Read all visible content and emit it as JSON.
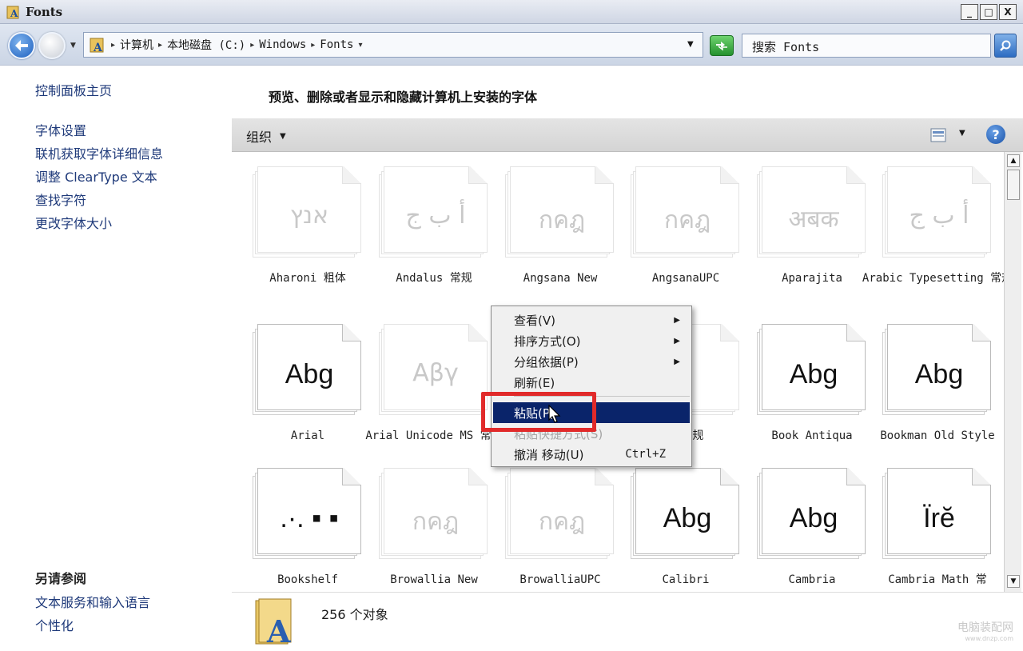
{
  "window": {
    "title": "Fonts",
    "minimize": "_",
    "maximize": "□",
    "close": "X"
  },
  "address": {
    "crumbs": [
      "计算机",
      "本地磁盘 (C:)",
      "Windows",
      "Fonts"
    ],
    "search_placeholder": "搜索 Fonts"
  },
  "sidebar": {
    "home": "控制面板主页",
    "links": [
      "字体设置",
      "联机获取字体详细信息",
      "调整 ClearType 文本",
      "查找字符",
      "更改字体大小"
    ],
    "see_also_heading": "另请参阅",
    "see_also": [
      "文本服务和输入语言",
      "个性化"
    ]
  },
  "main": {
    "heading": "预览、删除或者显示和隐藏计算机上安装的字体",
    "organize": "组织",
    "help": "?"
  },
  "fonts": [
    {
      "name": "Aharoni 粗体",
      "sample": "אנץ",
      "style": "light"
    },
    {
      "name": "Andalus 常规",
      "sample": "أ ب ج",
      "style": "light"
    },
    {
      "name": "Angsana New",
      "sample": "กคฎ",
      "style": "light"
    },
    {
      "name": "AngsanaUPC",
      "sample": "กคฎ",
      "style": "light"
    },
    {
      "name": "Aparajita",
      "sample": "अबक",
      "style": "light"
    },
    {
      "name": "Arabic Typesetting 常规",
      "sample": "أ ب ج",
      "style": "light"
    },
    {
      "name": "Arial",
      "sample": "Abg",
      "style": "dark"
    },
    {
      "name": "Arial Unicode MS 常规",
      "sample": "Αβγ",
      "style": "light"
    },
    {
      "name": "",
      "sample": "",
      "style": "light"
    },
    {
      "name": "e 常规",
      "sample": "",
      "style": "light"
    },
    {
      "name": "Book Antiqua",
      "sample": "Abg",
      "style": "dark"
    },
    {
      "name": "Bookman Old Style",
      "sample": "Abg",
      "style": "dark"
    },
    {
      "name": "Bookshelf",
      "sample": ".·. ▪ ▪",
      "style": "dark"
    },
    {
      "name": "Browallia New",
      "sample": "กคฎ",
      "style": "light"
    },
    {
      "name": "BrowalliaUPC",
      "sample": "กคฎ",
      "style": "light"
    },
    {
      "name": "Calibri",
      "sample": "Abg",
      "style": "dark"
    },
    {
      "name": "Cambria",
      "sample": "Abg",
      "style": "dark"
    },
    {
      "name": "Cambria Math 常",
      "sample": "Ïrĕ",
      "style": "dark"
    }
  ],
  "context_menu": {
    "view": "查看(V)",
    "sort": "排序方式(O)",
    "group": "分组依据(P)",
    "refresh": "刷新(E)",
    "paste": "粘贴(P)",
    "paste_shortcut": "粘贴快捷方式(S)",
    "undo": "撤消 移动(U)",
    "undo_shortcut": "Ctrl+Z"
  },
  "status": {
    "count": "256 个对象"
  },
  "watermark": {
    "text": "电脑装配网",
    "url": "www.dnzp.com"
  },
  "colors": {
    "menu_highlight": "#0a246a",
    "annotation_box": "#e12a2a",
    "link": "#1f3a7a"
  }
}
